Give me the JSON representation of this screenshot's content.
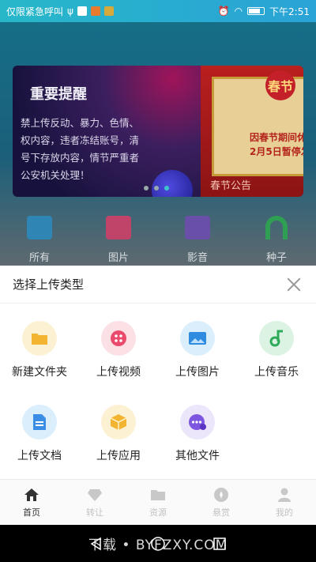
{
  "status_bar": {
    "carrier_text": "仅限紧急呼叫",
    "time": "下午2:51"
  },
  "banner": {
    "title": "重要提醒",
    "lines": [
      "禁上传反动、暴力、色情、",
      "权内容，违者冻结账号，清",
      "号下存放内容，情节严重者",
      "公安机关处理！"
    ],
    "right_badge": "春节",
    "right_line1": "因春节期间休",
    "right_line2": "2月5日暂停发",
    "right_caption": "春节公告"
  },
  "categories": [
    {
      "label": "所有",
      "color": "#2f86b5"
    },
    {
      "label": "图片",
      "color": "#c0436a"
    },
    {
      "label": "影音",
      "color": "#6a4fa8"
    },
    {
      "label": "种子",
      "color": "#2f9f53"
    }
  ],
  "sheet": {
    "title": "选择上传类型",
    "options": [
      {
        "label": "新建文件夹",
        "bg": "#fdf1d4",
        "icon": "folder-icon",
        "color": "#f3b531"
      },
      {
        "label": "上传视频",
        "bg": "#fbe0e6",
        "icon": "video-icon",
        "color": "#ea4a6c"
      },
      {
        "label": "上传图片",
        "bg": "#dbeefb",
        "icon": "image-icon",
        "color": "#2f8be0"
      },
      {
        "label": "上传音乐",
        "bg": "#dcf3e4",
        "icon": "music-icon",
        "color": "#2eaa5a"
      },
      {
        "label": "上传文档",
        "bg": "#dbeefb",
        "icon": "document-icon",
        "color": "#3b8ee6"
      },
      {
        "label": "上传应用",
        "bg": "#fdf1d4",
        "icon": "app-box-icon",
        "color": "#f3b531"
      },
      {
        "label": "其他文件",
        "bg": "#ece6fb",
        "icon": "other-file-icon",
        "color": "#7e57e0"
      }
    ]
  },
  "nav": {
    "items": [
      {
        "label": "首页",
        "icon": "home-icon"
      },
      {
        "label": "转让",
        "icon": "diamond-icon"
      },
      {
        "label": "资源",
        "icon": "folder-icon"
      },
      {
        "label": "悬赏",
        "icon": "reward-icon"
      },
      {
        "label": "我的",
        "icon": "user-icon"
      }
    ]
  },
  "watermark": "下载 • BYFZXY.COM"
}
